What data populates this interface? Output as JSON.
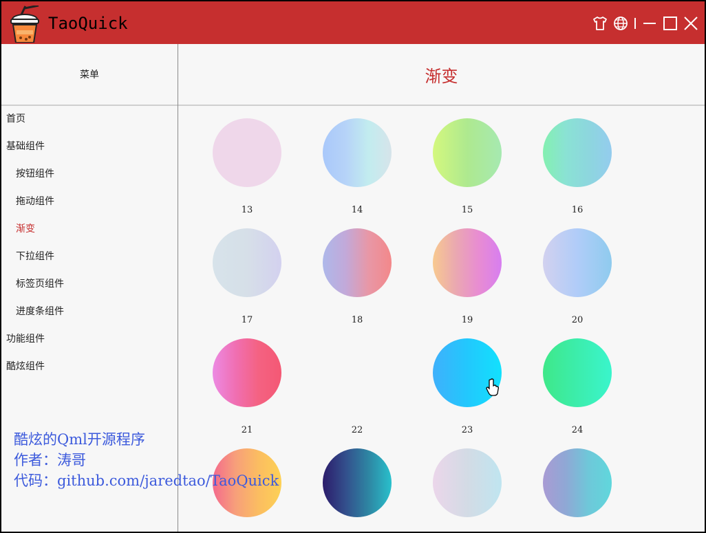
{
  "app": {
    "title": "TaoQuick"
  },
  "titlebar_buttons": [
    {
      "icon": "tshirt-icon",
      "name": "skin-button"
    },
    {
      "icon": "globe-icon",
      "name": "language-button"
    },
    {
      "icon": "minimize-icon",
      "name": "minimize-button"
    },
    {
      "icon": "maximize-icon",
      "name": "maximize-button"
    },
    {
      "icon": "close-icon",
      "name": "close-button"
    }
  ],
  "menu": {
    "header": "菜单",
    "items": [
      {
        "label": "首页",
        "level": 0,
        "active": false
      },
      {
        "label": "基础组件",
        "level": 0,
        "active": false
      },
      {
        "label": "按钮组件",
        "level": 1,
        "active": false
      },
      {
        "label": "拖动组件",
        "level": 1,
        "active": false
      },
      {
        "label": "渐变",
        "level": 1,
        "active": true
      },
      {
        "label": "下拉组件",
        "level": 1,
        "active": false
      },
      {
        "label": "标签页组件",
        "level": 1,
        "active": false
      },
      {
        "label": "进度条组件",
        "level": 1,
        "active": false
      },
      {
        "label": "功能组件",
        "level": 0,
        "active": false
      },
      {
        "label": "酷炫组件",
        "level": 0,
        "active": false
      }
    ]
  },
  "content": {
    "title": "渐变",
    "gradients": [
      {
        "label": "13",
        "colors": [
          "#efd7ea",
          "#efd7ea"
        ]
      },
      {
        "label": "14",
        "colors": [
          "#a9c8fa",
          "#b6d3f8",
          "#c2ecef",
          "#d6e4ea"
        ]
      },
      {
        "label": "15",
        "colors": [
          "#d4f87e",
          "#aee98f",
          "#a6e9b1"
        ]
      },
      {
        "label": "16",
        "colors": [
          "#84f0b0",
          "#8ae2d4",
          "#8dd6de",
          "#94ccee"
        ]
      },
      {
        "label": "17",
        "colors": [
          "#d7e3ea",
          "#d6dfe8",
          "#d3d1ef"
        ]
      },
      {
        "label": "18",
        "colors": [
          "#aeb8ea",
          "#c2a9d9",
          "#e897a6",
          "#f3888a"
        ]
      },
      {
        "label": "19",
        "colors": [
          "#f8c98f",
          "#eaa8b1",
          "#e88cd2",
          "#d77ef0"
        ]
      },
      {
        "label": "20",
        "colors": [
          "#d2d1ef",
          "#b0ccf8",
          "#8fcbee"
        ]
      },
      {
        "label": "21",
        "colors": [
          "#ec8ae3",
          "#f06fb2",
          "#f46282",
          "#f45874"
        ]
      },
      {
        "label": "22",
        "colors": []
      },
      {
        "label": "23",
        "colors": [
          "#3fb0fb",
          "#22c8fd",
          "#12e1fd"
        ]
      },
      {
        "label": "24",
        "colors": [
          "#3fe889",
          "#3cedac",
          "#3af5cc"
        ]
      },
      {
        "label": "",
        "colors": [
          "#f46a8d",
          "#f79f7a",
          "#fbbd61",
          "#fdd155"
        ]
      },
      {
        "label": "",
        "colors": [
          "#2c1c6b",
          "#334f8c",
          "#2e86a3",
          "#29c0cc"
        ]
      },
      {
        "label": "",
        "colors": [
          "#ebd6ea",
          "#d3dbe5",
          "#bfe5f0"
        ]
      },
      {
        "label": "",
        "colors": [
          "#a99bd4",
          "#8fa8d5",
          "#6ec8d9",
          "#60d7dc"
        ]
      }
    ]
  },
  "watermark": {
    "line1": "酷炫的Qml开源程序",
    "line2": "作者：涛哥",
    "line3": "代码：github.com/jaredtao/TaoQuick"
  }
}
